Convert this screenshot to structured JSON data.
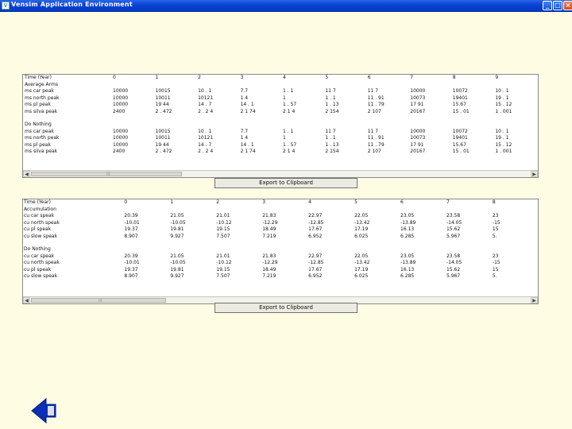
{
  "window": {
    "title": "Vensim Application Environment",
    "minimize_glyph": "_",
    "maximize_glyph": "□",
    "close_glyph": "×"
  },
  "table1": {
    "columns": [
      "Time (Year)",
      "0",
      "1",
      "2",
      "3",
      "4",
      "5",
      "6",
      "7",
      "8",
      "9"
    ],
    "rows": [
      {
        "label": "Average Arms",
        "values": []
      },
      {
        "label": "ms car peak",
        "values": [
          "10000",
          "10015",
          "10 . 1",
          "7.7",
          "1 . 1",
          "11 7",
          "11 7",
          "10000",
          "10072",
          "10 . 1"
        ]
      },
      {
        "label": "ms north peak",
        "values": [
          "10000",
          "10011",
          "10121",
          "1 4",
          "1",
          "1 . 1",
          "11 . 91",
          "10073",
          "19401",
          "19 . 1"
        ]
      },
      {
        "label": "ms pl peak",
        "values": [
          "10000",
          "19 44",
          "14 . 7",
          "14 . 1",
          "1 . 57",
          "1 . 13",
          "11 . 79",
          "17 91",
          "15.67",
          "15 . 12"
        ]
      },
      {
        "label": "ms silva peak",
        "values": [
          "2400",
          "2 . 472",
          "2 . 2 4",
          "2 1 74",
          "2 1 4",
          "2 154",
          "2 107",
          "20167",
          "15 . 01",
          "1 . 001"
        ]
      },
      {
        "gap": true,
        "label": "",
        "values": []
      },
      {
        "label": "Do Nothing",
        "values": []
      },
      {
        "label": "ms car peak",
        "values": [
          "10000",
          "10015",
          "10 . 1",
          "7.7",
          "1 . 1",
          "11 7",
          "11 7",
          "10000",
          "10072",
          "10 . 1"
        ]
      },
      {
        "label": "ms north peak",
        "values": [
          "10000",
          "10011",
          "10121",
          "1 4",
          "1",
          "1 . 1",
          "11 . 91",
          "10073",
          "19401",
          "19 . 1"
        ]
      },
      {
        "label": "ms pl peak",
        "values": [
          "10000",
          "19 44",
          "14 . 7",
          "14 . 1",
          "1 . 57",
          "1 . 13",
          "11 . 79",
          "17 91",
          "15.67",
          "15 . 12"
        ]
      },
      {
        "label": "ms silva peak",
        "values": [
          "2400",
          "2 . 472",
          "2 . 2 4",
          "2 1 74",
          "2 1 4",
          "2 154",
          "2 107",
          "20167",
          "15 . 01",
          "1 . 001"
        ]
      }
    ],
    "export_label": "Export to Clipboard"
  },
  "table2": {
    "columns": [
      "Time (Year)",
      "0",
      "1",
      "2",
      "3",
      "4",
      "5",
      "6",
      "7",
      "8"
    ],
    "rows": [
      {
        "label": "Accumulation",
        "values": []
      },
      {
        "label": "cu car speak",
        "values": [
          "20.39",
          "21.05",
          "21.01",
          "21.83",
          "22.97",
          "22.05",
          "23.05",
          "23.58",
          "23"
        ]
      },
      {
        "label": "cu north speak",
        "values": [
          "-10.01",
          "-10.05",
          "-10.12",
          "-12.29",
          "-12.85",
          "-13.42",
          "-13.89",
          "-14.05",
          "-15"
        ]
      },
      {
        "label": "cu pl speak",
        "values": [
          "19.37",
          "19.81",
          "19.15",
          "18.49",
          "17.67",
          "17.19",
          "16.13",
          "15.62",
          "15"
        ]
      },
      {
        "label": "cu slow speak",
        "values": [
          "8.907",
          "9.927",
          "7.507",
          "7.219",
          "6.952",
          "6.025",
          "6.285",
          "5.967",
          "5."
        ]
      },
      {
        "gap": true,
        "label": "",
        "values": []
      },
      {
        "label": "Do Nothing",
        "values": []
      },
      {
        "label": "cu car speak",
        "values": [
          "20.39",
          "21.05",
          "21.01",
          "21.83",
          "22.97",
          "22.05",
          "23.05",
          "23.58",
          "23"
        ]
      },
      {
        "label": "cu north speak",
        "values": [
          "-10.01",
          "-10.05",
          "-10.12",
          "-12.29",
          "-12.85",
          "-13.42",
          "-13.89",
          "-14.05",
          "-15"
        ]
      },
      {
        "label": "cu pl speak",
        "values": [
          "19.37",
          "19.81",
          "19.15",
          "18.49",
          "17.67",
          "17.19",
          "16.13",
          "15.62",
          "15"
        ]
      },
      {
        "label": "cu slow speak",
        "values": [
          "8.907",
          "9.927",
          "7.507",
          "7.219",
          "6.952",
          "6.025",
          "6.285",
          "5.967",
          "5."
        ]
      }
    ],
    "export_label": "Export to Clipboard"
  },
  "colors": {
    "background": "#fefde3",
    "titlebar": "#0a45d6",
    "back_arrow": "#0a2fb8"
  },
  "icons": {
    "app": "vensim-app-icon",
    "back": "back-arrow-icon"
  }
}
